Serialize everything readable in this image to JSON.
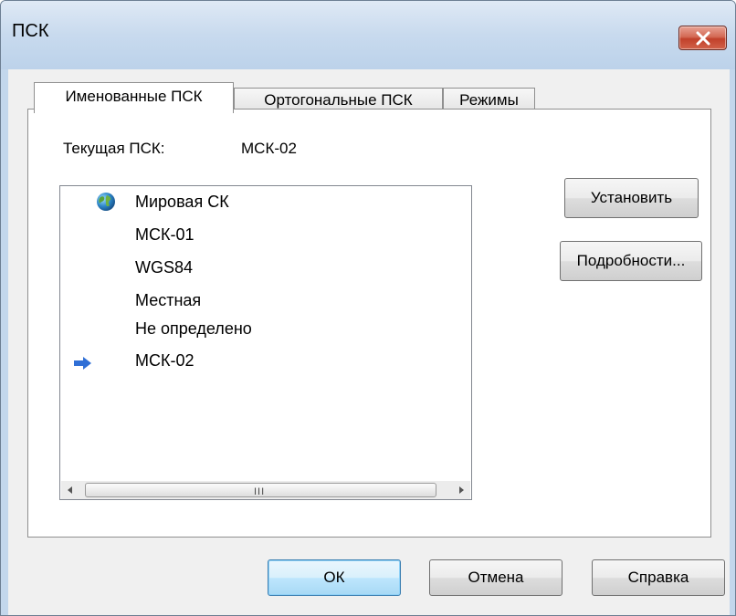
{
  "window": {
    "title": "ПСК"
  },
  "tabs": [
    {
      "label": "Именованные ПСК",
      "active": true
    },
    {
      "label": "Ортогональные ПСК",
      "active": false
    },
    {
      "label": "Режимы",
      "active": false
    }
  ],
  "current": {
    "label": "Текущая ПСК:",
    "value": "МСК-02"
  },
  "list": {
    "items": [
      {
        "label": "Мировая СК",
        "icon": "globe-icon"
      },
      {
        "label": "МСК-01"
      },
      {
        "label": "WGS84"
      },
      {
        "label": "Местная"
      },
      {
        "label": "Не определено"
      },
      {
        "label": "МСК-02",
        "icon": "arrow-right-icon",
        "current": true
      }
    ],
    "scroll_grip": "III"
  },
  "side_buttons": {
    "set": "Установить",
    "details": "Подробности..."
  },
  "footer": {
    "ok": "ОК",
    "cancel": "Отмена",
    "help": "Справка"
  },
  "colors": {
    "titlebar": "#c8daee",
    "close_button": "#c94a34",
    "arrow": "#2f6fd6",
    "default_button_border": "#3c7fb1"
  }
}
